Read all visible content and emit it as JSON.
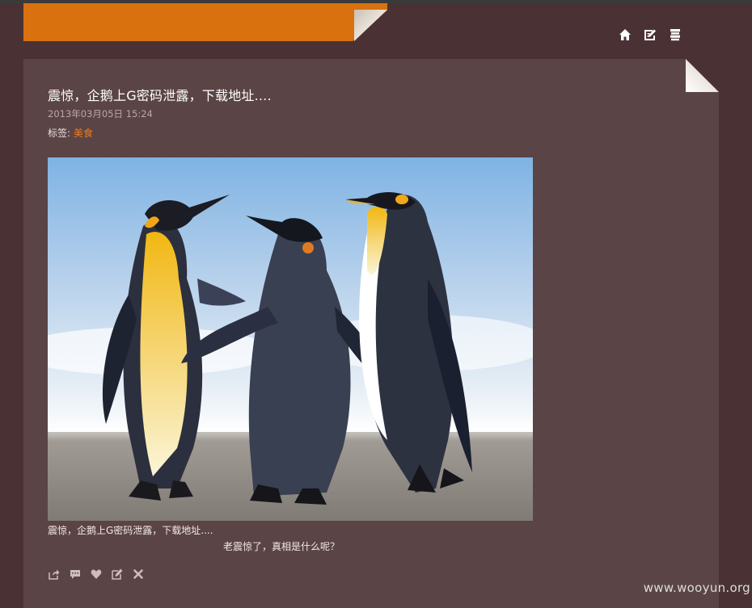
{
  "header": {
    "accent_color": "#d9710f",
    "icons": [
      "home-icon",
      "edit-icon",
      "list-icon"
    ]
  },
  "post": {
    "title": "震惊，企鹅上G密码泄露，下载地址....",
    "date": "2013年03月05日 15:24",
    "tags_label": "标签:",
    "tag": "美食",
    "image_alt": "三只企鹅在海滩上",
    "caption_left": "震惊，企鹅上G密码泄露，下载地址....",
    "caption_right": "老震惊了，真相是什么呢？",
    "actions": [
      "share-icon",
      "comment-icon",
      "like-icon",
      "edit-icon",
      "delete-icon"
    ]
  },
  "watermark": "www.wooyun.org"
}
